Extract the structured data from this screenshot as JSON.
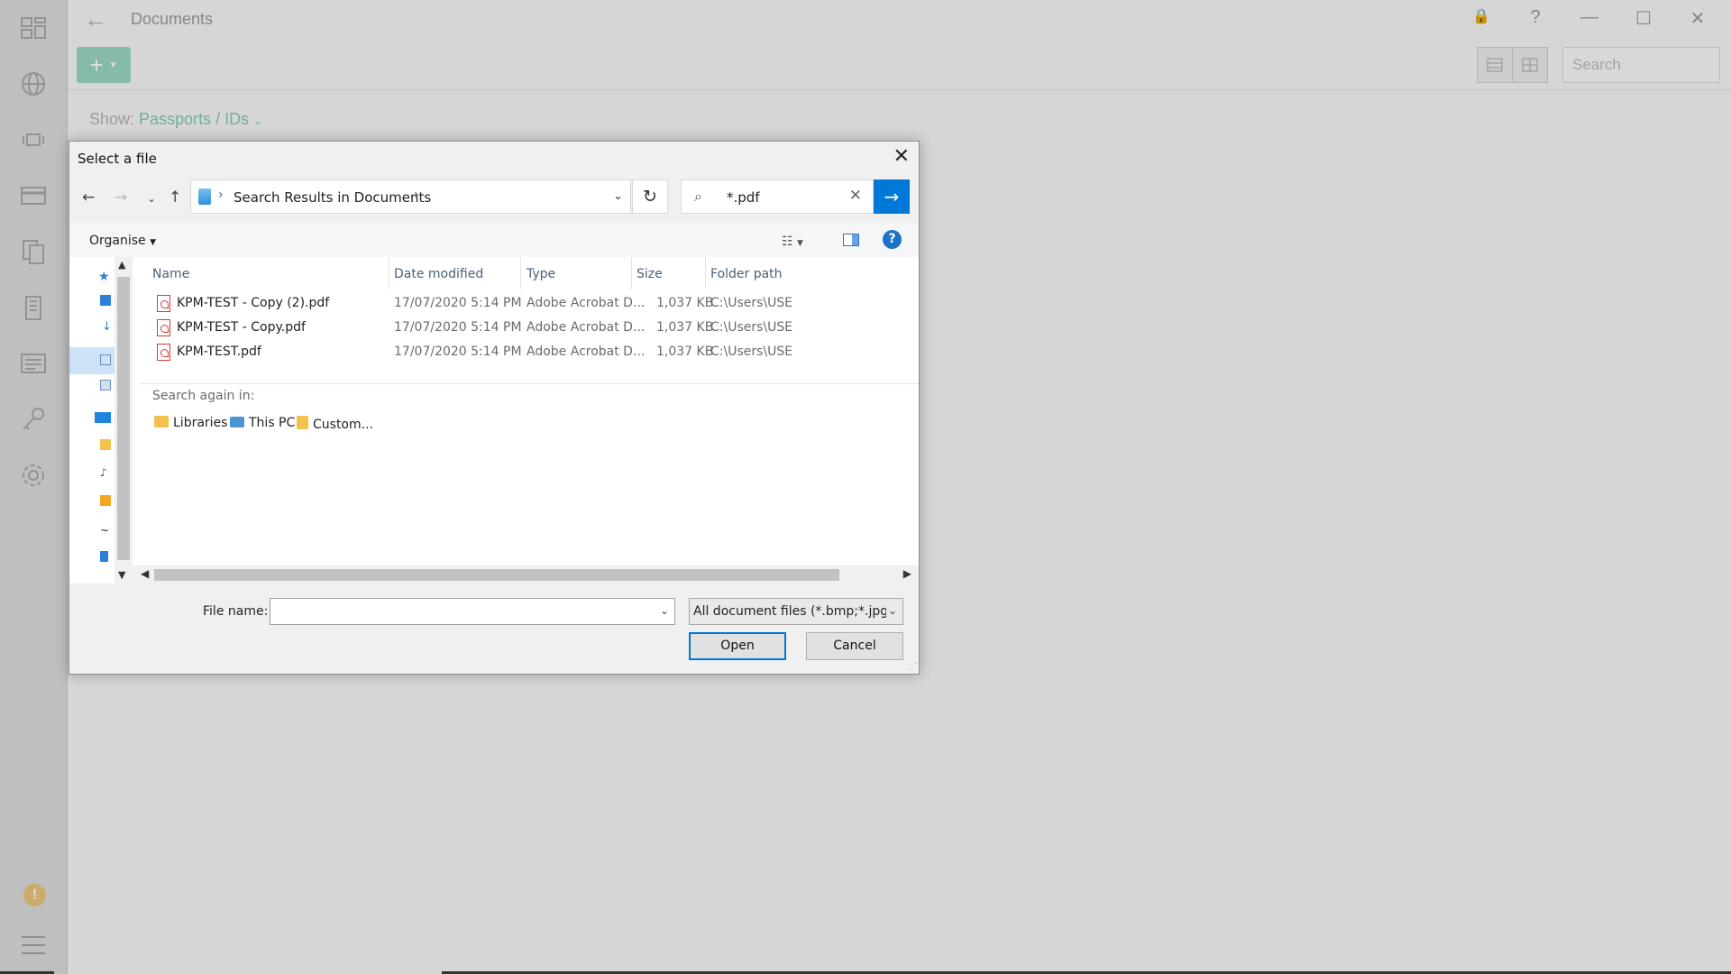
{
  "app": {
    "title": "Documents",
    "search_placeholder": "Search",
    "show_label": "Show:",
    "show_value": "Passports / IDs",
    "add_label": "+",
    "warning_badge": "!",
    "window_controls": {
      "lock": "🔒",
      "help": "?",
      "minimize": "—",
      "maximize": "☐",
      "close": "✕"
    },
    "sidebar_icons": [
      "dashboard-icon",
      "globe-icon",
      "devices-icon",
      "card-icon",
      "documents-icon",
      "building-icon",
      "notes-icon",
      "key-icon",
      "settings-icon"
    ],
    "accent_color": "#83c9b2"
  },
  "dialog": {
    "title": "Select a file",
    "address": {
      "location": "Search Results in Documents"
    },
    "search": {
      "value": "*.pdf"
    },
    "organise_label": "Organise",
    "columns": [
      "Name",
      "Date modified",
      "Type",
      "Size",
      "Folder path"
    ],
    "files": [
      {
        "name": "KPM-TEST - Copy (2).pdf",
        "date": "17/07/2020 5:14 PM",
        "type": "Adobe Acrobat D...",
        "size": "1,037 KB",
        "path": "C:\\Users\\USE"
      },
      {
        "name": "KPM-TEST - Copy.pdf",
        "date": "17/07/2020 5:14 PM",
        "type": "Adobe Acrobat D...",
        "size": "1,037 KB",
        "path": "C:\\Users\\USE"
      },
      {
        "name": "KPM-TEST.pdf",
        "date": "17/07/2020 5:14 PM",
        "type": "Adobe Acrobat D...",
        "size": "1,037 KB",
        "path": "C:\\Users\\USE"
      }
    ],
    "search_again": {
      "label": "Search again in:",
      "items": [
        "Libraries",
        "This PC",
        "Custom..."
      ]
    },
    "file_name_label": "File name:",
    "file_name_value": "",
    "file_type": "All document files (*.bmp;*.jpg;",
    "open_label": "Open",
    "cancel_label": "Cancel",
    "primary_color": "#0078d7"
  }
}
